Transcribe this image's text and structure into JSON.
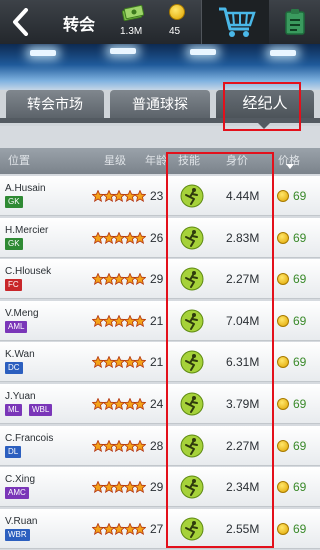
{
  "topbar": {
    "title": "转会",
    "cash": "1.3M",
    "coins": "45"
  },
  "tabs": [
    {
      "label": "转会市场"
    },
    {
      "label": "普通球探"
    },
    {
      "label": "经纪人"
    }
  ],
  "columns": {
    "position": "位置",
    "grade": "星级",
    "age": "年龄",
    "skill": "技能",
    "value": "身价",
    "price": "价格"
  },
  "colors": {
    "GK": "#2f8a34",
    "FC": "#c8262a",
    "AML": "#7a36b8",
    "DC": "#2c5fbf",
    "ML": "#7a36b8",
    "WBL": "#7a36b8",
    "DL": "#2c5fbf",
    "AMC": "#7a36b8",
    "WBR": "#2c5fbf"
  },
  "players": [
    {
      "name": "A.Husain",
      "positions": [
        "GK"
      ],
      "stars": 5,
      "age": "23",
      "value": "4.44M",
      "price": "69"
    },
    {
      "name": "H.Mercier",
      "positions": [
        "GK"
      ],
      "stars": 5,
      "age": "26",
      "value": "2.83M",
      "price": "69"
    },
    {
      "name": "C.Hlousek",
      "positions": [
        "FC"
      ],
      "stars": 5,
      "age": "29",
      "value": "2.27M",
      "price": "69"
    },
    {
      "name": "V.Meng",
      "positions": [
        "AML"
      ],
      "stars": 5,
      "age": "21",
      "value": "7.04M",
      "price": "69"
    },
    {
      "name": "K.Wan",
      "positions": [
        "DC"
      ],
      "stars": 5,
      "age": "21",
      "value": "6.31M",
      "price": "69"
    },
    {
      "name": "J.Yuan",
      "positions": [
        "ML",
        "WBL"
      ],
      "stars": 5,
      "age": "24",
      "value": "3.79M",
      "price": "69"
    },
    {
      "name": "C.Francois",
      "positions": [
        "DL"
      ],
      "stars": 5,
      "age": "28",
      "value": "2.27M",
      "price": "69"
    },
    {
      "name": "C.Xing",
      "positions": [
        "AMC"
      ],
      "stars": 5,
      "age": "29",
      "value": "2.34M",
      "price": "69"
    },
    {
      "name": "V.Ruan",
      "positions": [
        "WBR"
      ],
      "stars": 5,
      "age": "27",
      "value": "2.55M",
      "price": "69"
    }
  ]
}
